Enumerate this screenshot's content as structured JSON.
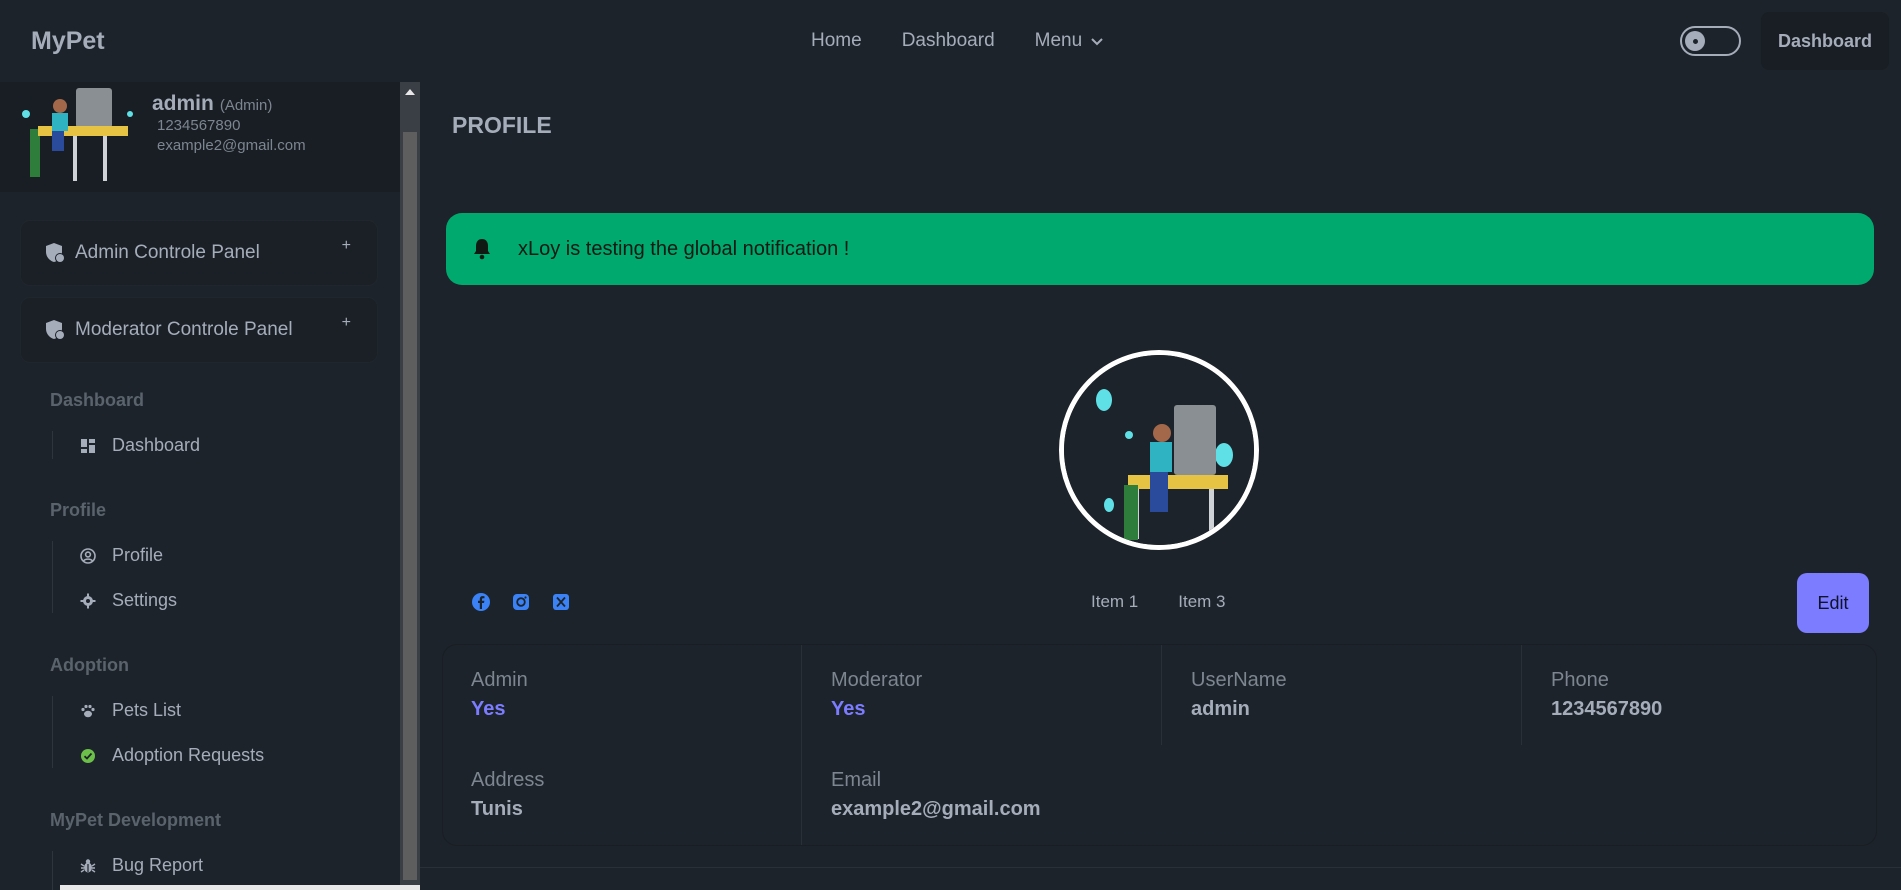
{
  "app": {
    "brand": "MyPet"
  },
  "nav": {
    "home": "Home",
    "dashboard": "Dashboard",
    "menu": "Menu",
    "dashboard_button": "Dashboard"
  },
  "sidebar": {
    "user": {
      "name": "admin",
      "role": "(Admin)",
      "phone": "1234567890",
      "email": "example2@gmail.com"
    },
    "panels": [
      {
        "label": "Admin Controle Panel",
        "toggle": "+"
      },
      {
        "label": "Moderator Controle Panel",
        "toggle": "+"
      }
    ],
    "sections": [
      {
        "title": "Dashboard",
        "items": [
          {
            "label": "Dashboard",
            "icon": "grid-icon"
          }
        ]
      },
      {
        "title": "Profile",
        "items": [
          {
            "label": "Profile",
            "icon": "user-circle-icon"
          },
          {
            "label": "Settings",
            "icon": "gear-icon"
          }
        ]
      },
      {
        "title": "Adoption",
        "items": [
          {
            "label": "Pets List",
            "icon": "paw-icon"
          },
          {
            "label": "Adoption Requests",
            "icon": "check-circle-icon"
          }
        ]
      },
      {
        "title": "MyPet Development",
        "items": [
          {
            "label": "Bug Report",
            "icon": "bug-icon"
          }
        ]
      }
    ]
  },
  "main": {
    "title": "PROFILE",
    "notification": "xLoy is testing the global notification !",
    "tabs": [
      "Item 1",
      "Item 3"
    ],
    "edit_label": "Edit",
    "stats": [
      {
        "label": "Admin",
        "value": "Yes"
      },
      {
        "label": "Moderator",
        "value": "Yes"
      },
      {
        "label": "UserName",
        "value": "admin"
      },
      {
        "label": "Phone",
        "value": "1234567890"
      },
      {
        "label": "Address",
        "value": "Tunis"
      },
      {
        "label": "Email",
        "value": "example2@gmail.com"
      }
    ]
  },
  "colors": {
    "background": "#1d232a",
    "success": "#00a96e",
    "primary": "#7b7cff",
    "text": "#a6adba"
  }
}
